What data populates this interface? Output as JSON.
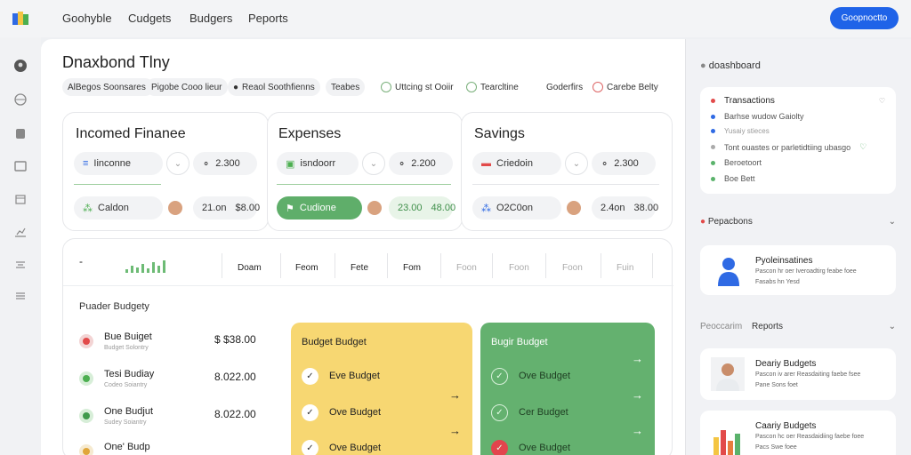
{
  "topnav": {
    "brand": "Goohyble",
    "items": [
      "Cudgets",
      "Budgers",
      "Peports"
    ],
    "cta": "Goopnoctto"
  },
  "page": {
    "title": "Dnaxbond Tlny",
    "chips": [
      "AlBegos Soonsares.",
      "Pigobe Cooo lieur",
      "Reaol Soothfienns",
      "Teabes",
      "Uttcing st Ooiir",
      "Tearcltine",
      "Goderfirs",
      "Carebe Belty"
    ]
  },
  "summary_cards": [
    {
      "title": "Incomed Finanee",
      "pill_label": "Iinconne",
      "pill_value": "2.300",
      "row_label": "Caldon",
      "row_val1": "21.on",
      "row_val2": "$8.00"
    },
    {
      "title": "Expenses",
      "pill_label": "isndoorr",
      "pill_value": "2.200",
      "row_label": "Cudione",
      "row_val1": "23.00",
      "row_val2": "48.00"
    },
    {
      "title": "Savings",
      "pill_label": "Criedoin",
      "pill_value": "2.300",
      "row_label": "O2C0on",
      "row_val1": "2.4on",
      "row_val2": "38.00"
    }
  ],
  "chart_strip": {
    "minus": "-",
    "columns": [
      "Doam",
      "Feom",
      "Fete",
      "Fom",
      "Foon",
      "Foon",
      "Foon",
      "Fuin"
    ]
  },
  "budgets": {
    "title": "Puader Budgety",
    "rows": [
      {
        "name": "Bue Buiget",
        "sub": "Budget Solontry",
        "amount": "$ $38.00"
      },
      {
        "name": "Tesi Budiay",
        "sub": "Codeo Soiantry",
        "amount": "8.022.00"
      },
      {
        "name": "One Budjut",
        "sub": "Sudey Soiantry",
        "amount": "8.022.00"
      },
      {
        "name": "One' Budp",
        "sub": "",
        "amount": ""
      }
    ],
    "yellow_card": {
      "title": "Budget Budget",
      "items": [
        "Eve Budget",
        "Ove Budget",
        "Ove Budget"
      ]
    },
    "green_card": {
      "title": "Bugir  Budget",
      "items": [
        "Ove Budget",
        "Cer Budget",
        "Ove Budget"
      ]
    }
  },
  "right_panel": {
    "dashboard_label": "doashboard",
    "transactions": {
      "title": "Transactions",
      "rows": [
        "Barhse wudow Gaiolty",
        "Yusaiy stieces",
        "Tont ouastes or parletidtiing ubasgo",
        "Beroetoort",
        "Boe Bett"
      ],
      "dot_colors": [
        "#e24a4a",
        "#2f6ae4",
        "#2f6ae4",
        "#aaaaaa",
        "#5ab26b",
        "#5ab26b"
      ]
    },
    "section1": {
      "title": "Pepacbons"
    },
    "payments_card": {
      "title": "Pyoleinsatines",
      "lines": [
        "Pascon hr oer Iveroadtirg feabe foee",
        "Fasabs hn Yesd"
      ]
    },
    "section2": {
      "left": "Peoccarim",
      "title": "Reports"
    },
    "report_cards": [
      {
        "title": "Deariy Budgets",
        "lines": [
          "Pascon iv arer Reasdaiting faebe fsee",
          "Pane Sons foet"
        ]
      },
      {
        "title": "Caariy Budgets",
        "lines": [
          "Pascon hc oer Reasdaidiing faebe foee",
          "Pacs Swe foee"
        ]
      }
    ]
  },
  "colors": {
    "accent": "#1f63e8",
    "yellow": "#f7d772",
    "green": "#64b16f"
  }
}
